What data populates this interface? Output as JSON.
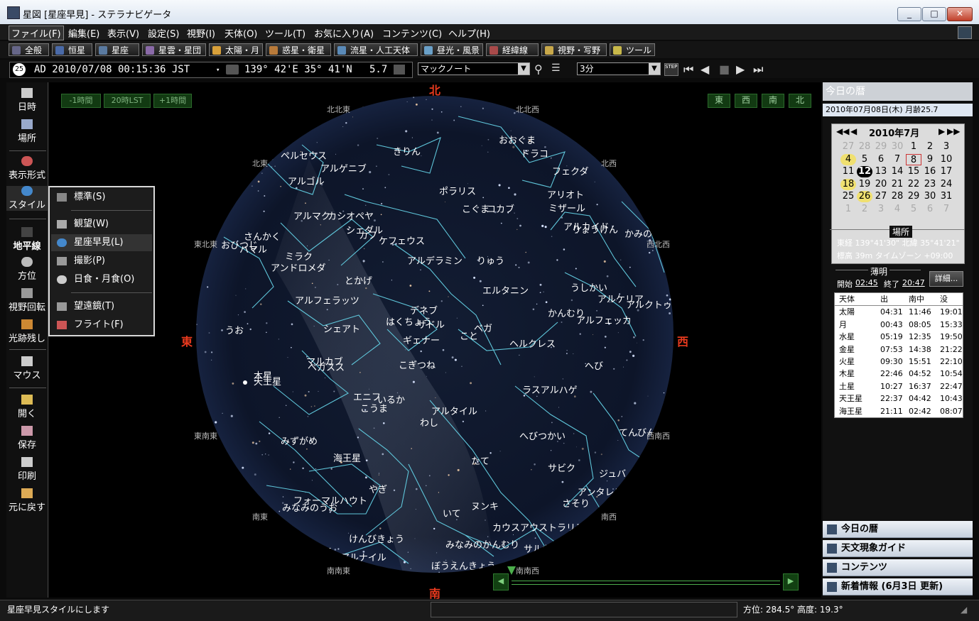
{
  "window": {
    "title": "星図 [星座早見] - ステラナビゲータ"
  },
  "menu": [
    "ファイル(F)",
    "編集(E)",
    "表示(V)",
    "設定(S)",
    "視野(I)",
    "天体(O)",
    "ツール(T)",
    "お気に入り(A)",
    "コンテンツ(C)",
    "ヘルプ(H)"
  ],
  "categories": [
    "全般",
    "恒星",
    "星座",
    "星雲・星団",
    "太陽・月",
    "惑星・衛星",
    "流星・人工天体",
    "昼光・風景",
    "経緯線",
    "視野・写野",
    "ツール"
  ],
  "infobar": {
    "clock_num": "25",
    "datetime": "AD 2010/07/08 00:15:36 JST",
    "position": "139° 42'E 35° 41'N",
    "mag": "5.7",
    "search_value": "マックノート",
    "step_value": "3分"
  },
  "left_toolbar": [
    "日時",
    "場所",
    "表示形式",
    "スタイル",
    "地平線",
    "方位",
    "視野回転",
    "光跡残し",
    "マウス",
    "開く",
    "保存",
    "印刷",
    "元に戻す"
  ],
  "style_popup": [
    "標準(S)",
    "観望(W)",
    "星座早見(L)",
    "撮影(P)",
    "日食・月食(O)",
    "望遠鏡(T)",
    "フライト(F)"
  ],
  "sky": {
    "cardinal": {
      "north": "北",
      "south": "南",
      "east": "東",
      "west": "西"
    },
    "time_buttons": [
      "-1時間",
      "20時LST",
      "+1時間"
    ],
    "compass_buttons": [
      "東",
      "西",
      "南",
      "北"
    ],
    "directions": [
      "北北東",
      "北北西",
      "北東",
      "北西",
      "東北東",
      "西北西",
      "東南東",
      "西南西",
      "南東",
      "南西",
      "南南東",
      "南南西"
    ],
    "constellations": [
      "ペルセウス",
      "きりん",
      "おおぐま",
      "ドラコ",
      "フェクダ",
      "アルゲニブ",
      "アルゴル",
      "ポラリス",
      "アリオト",
      "ミザール",
      "こぐま",
      "コカブ",
      "アルマク",
      "カシオペヤ",
      "シェダル",
      "カフ",
      "ケフェウス",
      "アルカイド",
      "りょうけん",
      "かみのけ",
      "さんかく",
      "ハマル",
      "おひつじ",
      "ミラク",
      "アンドロメダ",
      "アルデラミン",
      "りゅう",
      "とかげ",
      "エルタニン",
      "うしかい",
      "アルフェラッツ",
      "アルケリア",
      "アルクトゥー",
      "デネブ",
      "サドル",
      "はくちょう",
      "ベガ",
      "こと",
      "かんむり",
      "アルフェッカ",
      "シェアト",
      "うお",
      "ギェナー",
      "ヘルクレス",
      "マルカブ",
      "ペガスス",
      "こぎつね",
      "へび",
      "天王星",
      "木星",
      "ラスアルハゲ",
      "エニフ",
      "こうま",
      "いるか",
      "アルタイル",
      "わし",
      "へびつかい",
      "てんびん",
      "みずがめ",
      "海王星",
      "たて",
      "サビク",
      "ジュバ",
      "やぎ",
      "アンタレス",
      "さそり",
      "フォーマルハウト",
      "みなみのうお",
      "ヌンキ",
      "いて",
      "カウスアウストラリス",
      "けんびきょう",
      "みなみのかんむり",
      "サルガス",
      "つる",
      "アルナイル",
      "ぼうえんきょう"
    ]
  },
  "right_panel": {
    "header": "今日の暦",
    "date_line": "2010年07月08日(木)  月齢25.7",
    "calendar": {
      "month_label": "2010年7月",
      "weeks": [
        [
          "27",
          "28",
          "29",
          "30",
          "1",
          "2",
          "3"
        ],
        [
          "4",
          "5",
          "6",
          "7",
          "8",
          "9",
          "10"
        ],
        [
          "11",
          "12",
          "13",
          "14",
          "15",
          "16",
          "17"
        ],
        [
          "18",
          "19",
          "20",
          "21",
          "22",
          "23",
          "24"
        ],
        [
          "25",
          "26",
          "27",
          "28",
          "29",
          "30",
          "31"
        ],
        [
          "1",
          "2",
          "3",
          "4",
          "5",
          "6",
          "7"
        ]
      ]
    },
    "place_label": "場所",
    "lon_lat": "東経 139°41'30\"  北緯 35°41'21\"",
    "elev_tz": "標高 39m    タイムゾーン +09:00",
    "twilight_label": "薄明",
    "twilight_start_label": "開始",
    "twilight_start": "02:45",
    "twilight_end_label": "終了",
    "twilight_end": "20:47",
    "detail_button": "詳細...",
    "table_headers": [
      "天体",
      "出",
      "南中",
      "没"
    ],
    "table_rows": [
      [
        "太陽",
        "04:31",
        "11:46",
        "19:01"
      ],
      [
        "月",
        "00:43",
        "08:05",
        "15:33"
      ],
      [
        "水星",
        "05:19",
        "12:35",
        "19:50"
      ],
      [
        "金星",
        "07:53",
        "14:38",
        "21:22"
      ],
      [
        "火星",
        "09:30",
        "15:51",
        "22:10"
      ],
      [
        "木星",
        "22:46",
        "04:52",
        "10:54"
      ],
      [
        "土星",
        "10:27",
        "16:37",
        "22:47"
      ],
      [
        "天王星",
        "22:37",
        "04:42",
        "10:43"
      ],
      [
        "海王星",
        "21:11",
        "02:42",
        "08:07"
      ]
    ],
    "tabs": [
      "今日の暦",
      "天文現象ガイド",
      "コンテンツ",
      "新着情報 (6月3日 更新)"
    ]
  },
  "status": {
    "message": "星座早見スタイルにします",
    "azimuth_alt": "方位: 284.5°  高度:  19.3°"
  }
}
